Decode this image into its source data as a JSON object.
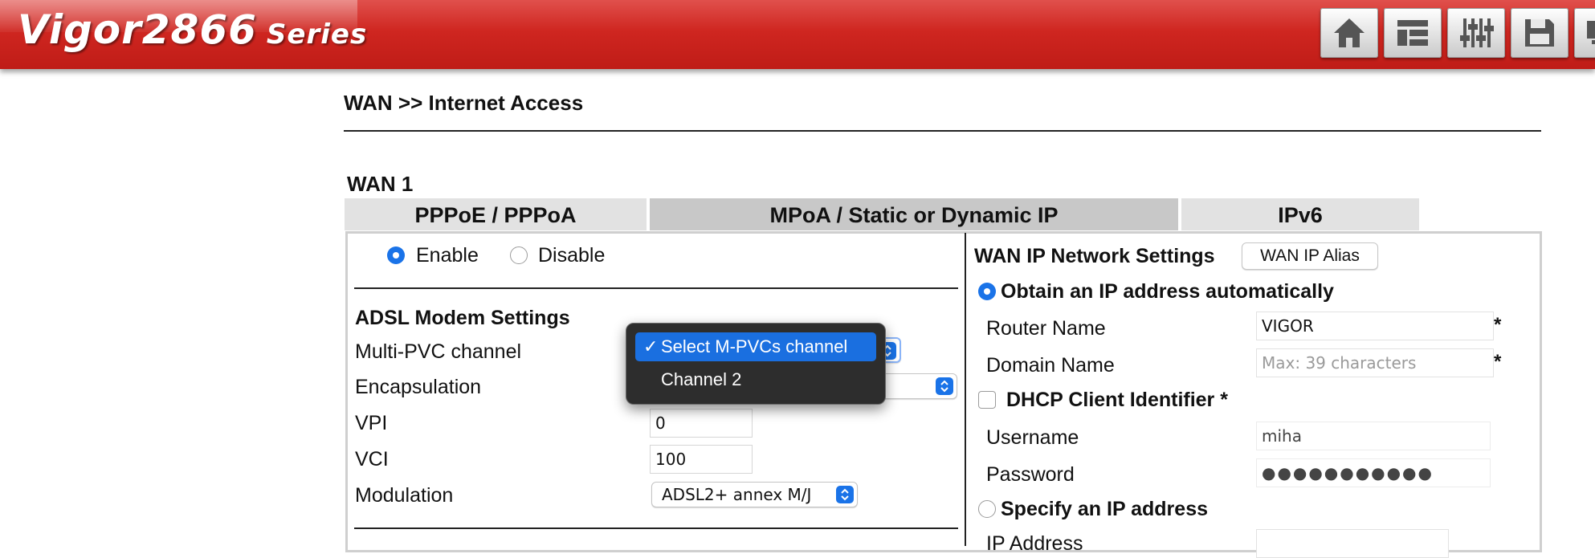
{
  "header": {
    "brand_model": "Vigor2866",
    "brand_series": "Series",
    "toolbar": [
      {
        "name": "home-icon"
      },
      {
        "name": "quick-start-icon"
      },
      {
        "name": "settings-sliders-icon"
      },
      {
        "name": "save-icon"
      },
      {
        "name": "monitor-icon"
      }
    ]
  },
  "page": {
    "breadcrumb": "WAN >> Internet Access",
    "wan_title": "WAN 1"
  },
  "tabs": [
    {
      "label": "PPPoE / PPPoA",
      "active": false
    },
    {
      "label": "MPoA / Static or Dynamic IP",
      "active": true
    },
    {
      "label": "IPv6",
      "active": false
    }
  ],
  "left": {
    "enable_label": "Enable",
    "disable_label": "Disable",
    "section_title": "ADSL Modem Settings",
    "multi_pvc_label": "Multi-PVC channel",
    "encapsulation_label": "Encapsulation",
    "vpi_label": "VPI",
    "vpi_value": "0",
    "vci_label": "VCI",
    "vci_value": "100",
    "modulation_label": "Modulation",
    "modulation_value": "ADSL2+ annex M/J"
  },
  "dropdown": {
    "options": [
      {
        "label": "Select M-PVCs channel",
        "selected": true
      },
      {
        "label": "Channel 2",
        "selected": false
      }
    ],
    "check_glyph": "✓"
  },
  "right": {
    "section_title": "WAN IP Network Settings",
    "alias_button": "WAN IP Alias",
    "obtain_label": "Obtain an IP address automatically",
    "router_name_label": "Router Name",
    "router_name_value": "VIGOR",
    "domain_name_label": "Domain Name",
    "domain_name_placeholder": "Max: 39 characters",
    "dhcp_label": "DHCP Client Identifier *",
    "username_label": "Username",
    "username_value": "miha",
    "password_label": "Password",
    "password_value": "●●●●●●●●●●●",
    "specify_label": "Specify an IP address",
    "ip_address_label": "IP Address",
    "required_mark": "*"
  },
  "colors": {
    "header_red": "#cf2620",
    "accent_blue": "#1a73e8",
    "tab_active": "#c8c8c8",
    "tab_inactive": "#e2e2e2"
  }
}
